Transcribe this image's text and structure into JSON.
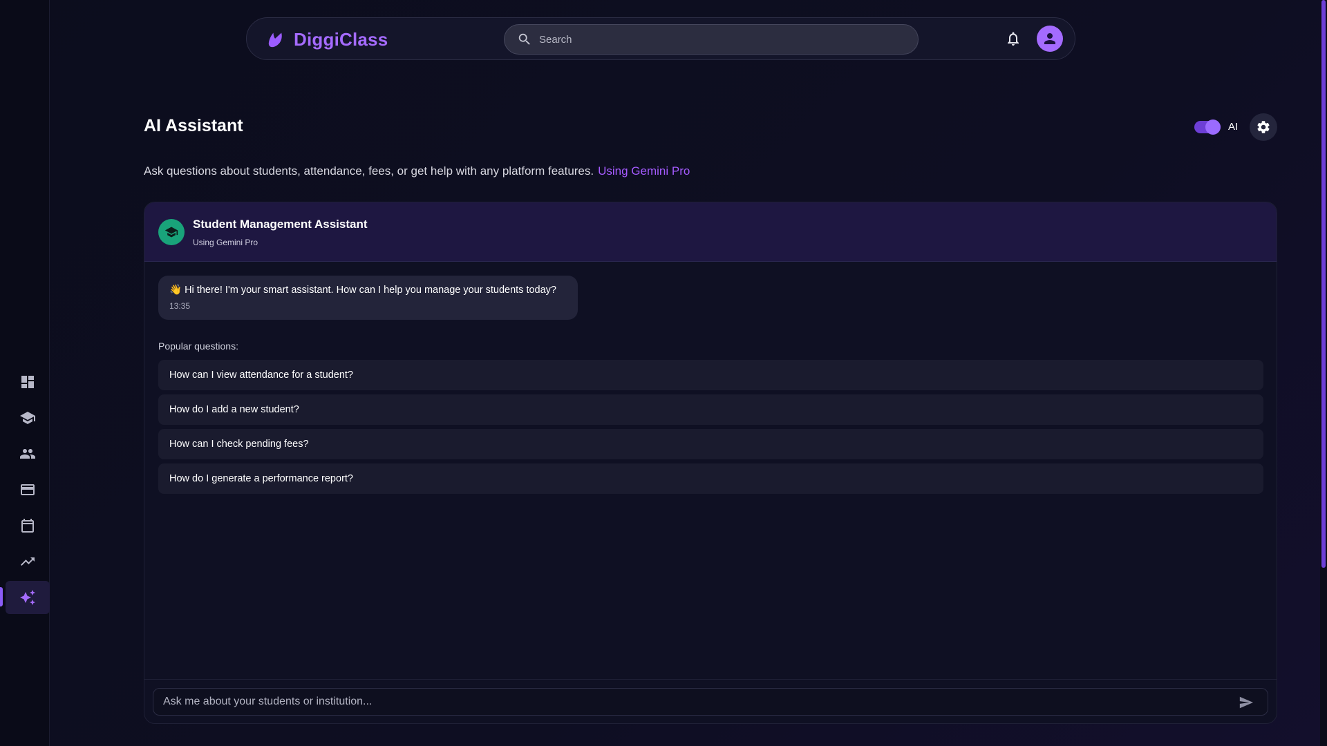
{
  "app": {
    "name": "DiggiClass"
  },
  "search": {
    "placeholder": "Search"
  },
  "page": {
    "title": "AI Assistant",
    "subtitle": "Ask questions about students, attendance, fees, or get help with any platform features.",
    "model_link": "Using Gemini Pro",
    "ai_toggle_label": "AI",
    "ai_toggle_on": true
  },
  "sidebar": {
    "items": [
      {
        "name": "dashboard",
        "icon": "dashboard-icon"
      },
      {
        "name": "students",
        "icon": "graduation-cap-icon"
      },
      {
        "name": "users",
        "icon": "people-icon"
      },
      {
        "name": "fees",
        "icon": "credit-card-icon"
      },
      {
        "name": "calendar",
        "icon": "calendar-icon"
      },
      {
        "name": "analytics",
        "icon": "trending-up-icon"
      },
      {
        "name": "ai-assistant",
        "icon": "sparkles-icon",
        "active": true
      }
    ]
  },
  "chat": {
    "assistant_name": "Student Management Assistant",
    "assistant_model": "Using Gemini Pro",
    "welcome_message": "👋 Hi there! I'm your smart assistant. How can I help you manage your students today?",
    "welcome_time": "13:35",
    "popular_label": "Popular questions:",
    "popular_questions": [
      "How can I view attendance for a student?",
      "How do I add a new student?",
      "How can I check pending fees?",
      "How do I generate a performance report?"
    ],
    "input_placeholder": "Ask me about your students or institution..."
  },
  "colors": {
    "accent": "#a56bff",
    "background": "#0c0d1d",
    "assistant_icon": "#19a37a"
  }
}
